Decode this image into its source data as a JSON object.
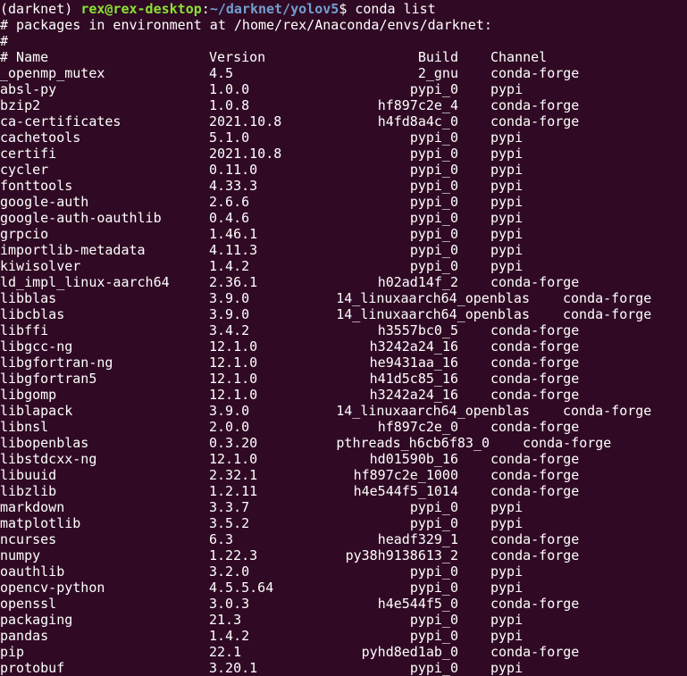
{
  "prompt": {
    "env": "(darknet) ",
    "user_host": "rex@rex-desktop",
    "sep": ":",
    "path": "~/darknet/yolov5",
    "symbol": "$ ",
    "command": "conda list"
  },
  "header_lines": [
    "# packages in environment at /home/rex/Anaconda/envs/darknet:",
    "#"
  ],
  "columns": {
    "name": "# Name",
    "version": "Version",
    "build": "Build",
    "channel": "Channel"
  },
  "packages": [
    {
      "name": "_openmp_mutex",
      "version": "4.5",
      "build": "2_gnu",
      "channel": "conda-forge"
    },
    {
      "name": "absl-py",
      "version": "1.0.0",
      "build": "pypi_0",
      "channel": "pypi"
    },
    {
      "name": "bzip2",
      "version": "1.0.8",
      "build": "hf897c2e_4",
      "channel": "conda-forge"
    },
    {
      "name": "ca-certificates",
      "version": "2021.10.8",
      "build": "h4fd8a4c_0",
      "channel": "conda-forge"
    },
    {
      "name": "cachetools",
      "version": "5.1.0",
      "build": "pypi_0",
      "channel": "pypi"
    },
    {
      "name": "certifi",
      "version": "2021.10.8",
      "build": "pypi_0",
      "channel": "pypi"
    },
    {
      "name": "cycler",
      "version": "0.11.0",
      "build": "pypi_0",
      "channel": "pypi"
    },
    {
      "name": "fonttools",
      "version": "4.33.3",
      "build": "pypi_0",
      "channel": "pypi"
    },
    {
      "name": "google-auth",
      "version": "2.6.6",
      "build": "pypi_0",
      "channel": "pypi"
    },
    {
      "name": "google-auth-oauthlib",
      "version": "0.4.6",
      "build": "pypi_0",
      "channel": "pypi"
    },
    {
      "name": "grpcio",
      "version": "1.46.1",
      "build": "pypi_0",
      "channel": "pypi"
    },
    {
      "name": "importlib-metadata",
      "version": "4.11.3",
      "build": "pypi_0",
      "channel": "pypi"
    },
    {
      "name": "kiwisolver",
      "version": "1.4.2",
      "build": "pypi_0",
      "channel": "pypi"
    },
    {
      "name": "ld_impl_linux-aarch64",
      "version": "2.36.1",
      "build": "h02ad14f_2",
      "channel": "conda-forge"
    },
    {
      "name": "libblas",
      "version": "3.9.0",
      "build": "14_linuxaarch64_openblas",
      "channel": "conda-forge",
      "layout": "wide"
    },
    {
      "name": "libcblas",
      "version": "3.9.0",
      "build": "14_linuxaarch64_openblas",
      "channel": "conda-forge",
      "layout": "wide"
    },
    {
      "name": "libffi",
      "version": "3.4.2",
      "build": "h3557bc0_5",
      "channel": "conda-forge"
    },
    {
      "name": "libgcc-ng",
      "version": "12.1.0",
      "build": "h3242a24_16",
      "channel": "conda-forge"
    },
    {
      "name": "libgfortran-ng",
      "version": "12.1.0",
      "build": "he9431aa_16",
      "channel": "conda-forge"
    },
    {
      "name": "libgfortran5",
      "version": "12.1.0",
      "build": "h41d5c85_16",
      "channel": "conda-forge"
    },
    {
      "name": "libgomp",
      "version": "12.1.0",
      "build": "h3242a24_16",
      "channel": "conda-forge"
    },
    {
      "name": "liblapack",
      "version": "3.9.0",
      "build": "14_linuxaarch64_openblas",
      "channel": "conda-forge",
      "layout": "wide"
    },
    {
      "name": "libnsl",
      "version": "2.0.0",
      "build": "hf897c2e_0",
      "channel": "conda-forge"
    },
    {
      "name": "libopenblas",
      "version": "0.3.20",
      "build": "pthreads_h6cb6f83_0",
      "channel": "conda-forge",
      "layout": "mid"
    },
    {
      "name": "libstdcxx-ng",
      "version": "12.1.0",
      "build": "hd01590b_16",
      "channel": "conda-forge"
    },
    {
      "name": "libuuid",
      "version": "2.32.1",
      "build": "hf897c2e_1000",
      "channel": "conda-forge"
    },
    {
      "name": "libzlib",
      "version": "1.2.11",
      "build": "h4e544f5_1014",
      "channel": "conda-forge"
    },
    {
      "name": "markdown",
      "version": "3.3.7",
      "build": "pypi_0",
      "channel": "pypi"
    },
    {
      "name": "matplotlib",
      "version": "3.5.2",
      "build": "pypi_0",
      "channel": "pypi"
    },
    {
      "name": "ncurses",
      "version": "6.3",
      "build": "headf329_1",
      "channel": "conda-forge"
    },
    {
      "name": "numpy",
      "version": "1.22.3",
      "build": "py38h9138613_2",
      "channel": "conda-forge"
    },
    {
      "name": "oauthlib",
      "version": "3.2.0",
      "build": "pypi_0",
      "channel": "pypi"
    },
    {
      "name": "opencv-python",
      "version": "4.5.5.64",
      "build": "pypi_0",
      "channel": "pypi"
    },
    {
      "name": "openssl",
      "version": "3.0.3",
      "build": "h4e544f5_0",
      "channel": "conda-forge"
    },
    {
      "name": "packaging",
      "version": "21.3",
      "build": "pypi_0",
      "channel": "pypi"
    },
    {
      "name": "pandas",
      "version": "1.4.2",
      "build": "pypi_0",
      "channel": "pypi"
    },
    {
      "name": "pip",
      "version": "22.1",
      "build": "pyhd8ed1ab_0",
      "channel": "conda-forge"
    },
    {
      "name": "protobuf",
      "version": "3.20.1",
      "build": "pypi_0",
      "channel": "pypi"
    }
  ]
}
